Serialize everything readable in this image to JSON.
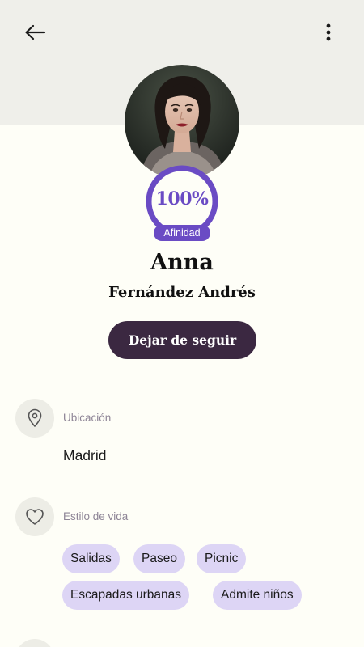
{
  "header": {
    "back_icon": "arrow-left-icon",
    "menu_icon": "more-vertical-icon"
  },
  "profile": {
    "affinity_value": "100%",
    "affinity_label": "Afinidad",
    "first_name": "Anna",
    "last_name": "Fernández Andrés",
    "unfollow_label": "Dejar de seguir",
    "affinity_fraction": 1.0
  },
  "location": {
    "icon": "map-pin-icon",
    "label": "Ubicación",
    "value": "Madrid"
  },
  "lifestyle": {
    "icon": "heart-icon",
    "label": "Estilo de vida",
    "tags": [
      "Salidas",
      "Paseo",
      "Picnic",
      "Escapadas urbanas",
      "Admite niños"
    ]
  },
  "colors": {
    "accent": "#6A4BC4",
    "button": "#3B2841",
    "chip": "#DDD5F5",
    "background": "#FEFEF7",
    "header_band": "#EFEFEA"
  }
}
